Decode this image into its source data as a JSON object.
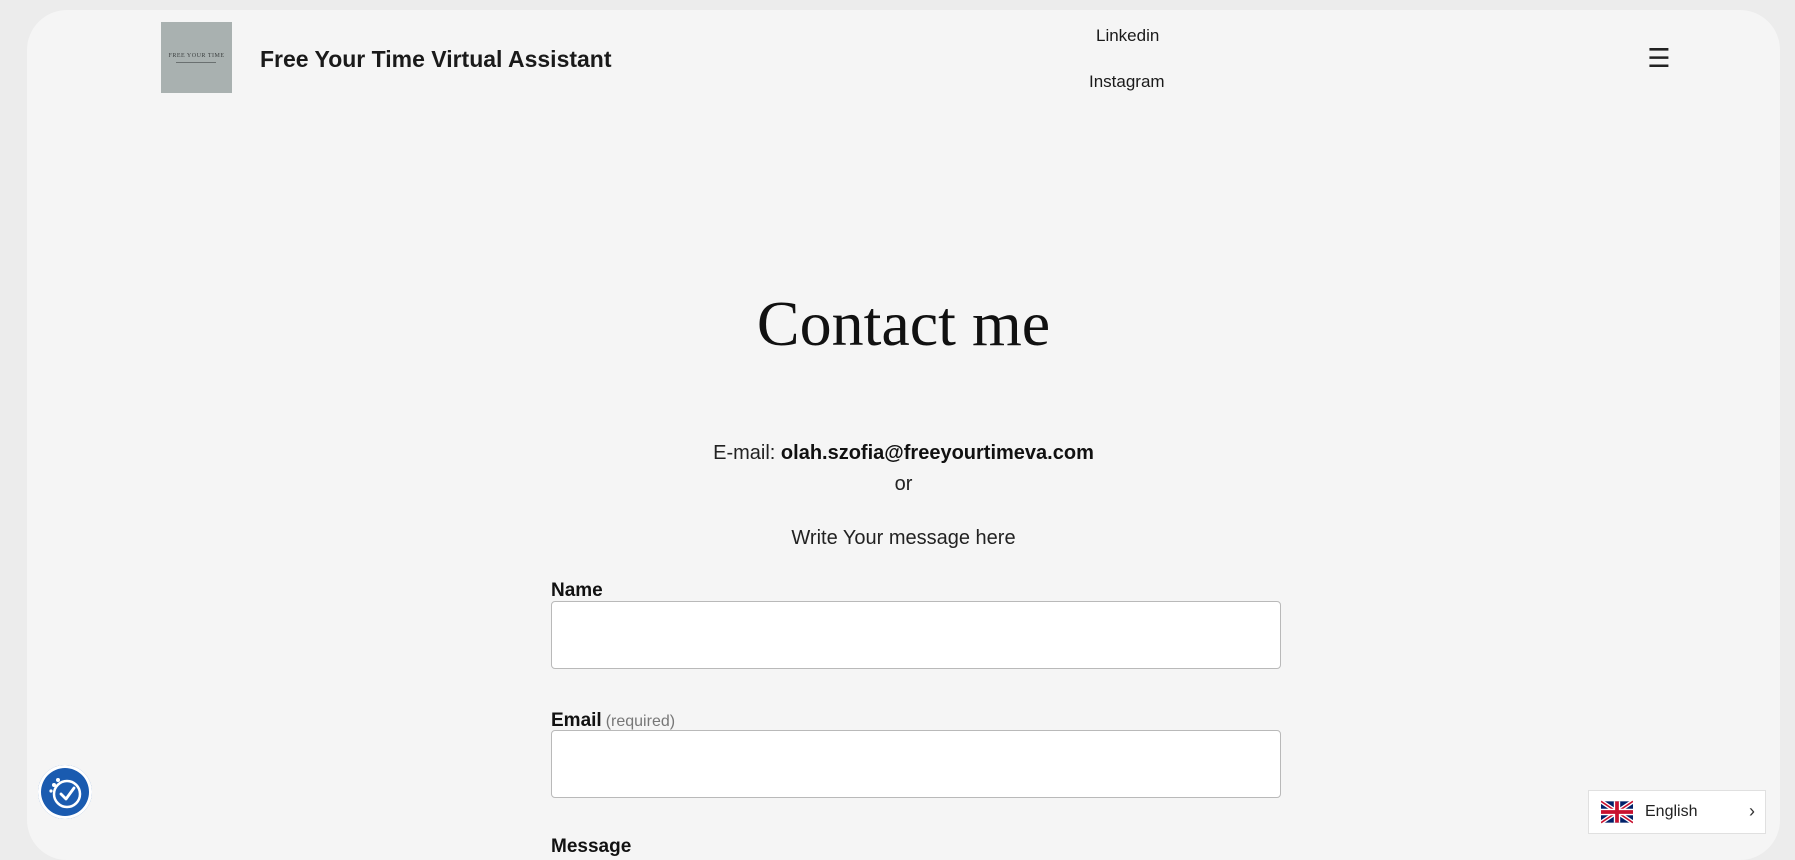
{
  "header": {
    "logo_text": "FREE YOUR TIME",
    "site_title": "Free Your Time Virtual Assistant",
    "nav": [
      {
        "label": "Linkedin"
      },
      {
        "label": "Instagram"
      }
    ],
    "menu_icon": "hamburger-icon",
    "menu_glyph": "☰"
  },
  "main": {
    "heading": "Contact me",
    "email_prefix": "E-mail:",
    "email_address": "olah.szofia@freeyourtimeva.com",
    "or_text": "or",
    "write_prompt": "Write Your message here",
    "form": {
      "name_label": "Name",
      "email_label": "Email",
      "email_required": "(required)",
      "message_label": "Message"
    }
  },
  "widgets": {
    "accessibility_icon": "accessibility-icon",
    "language": "English",
    "language_flag": "uk-flag-icon",
    "language_chevron": "›"
  },
  "colors": {
    "page_bg": "#f5f5f5",
    "outer_bg": "#ececec",
    "accent": "#1a5bb0",
    "logo_bg": "#a9b1b0"
  }
}
